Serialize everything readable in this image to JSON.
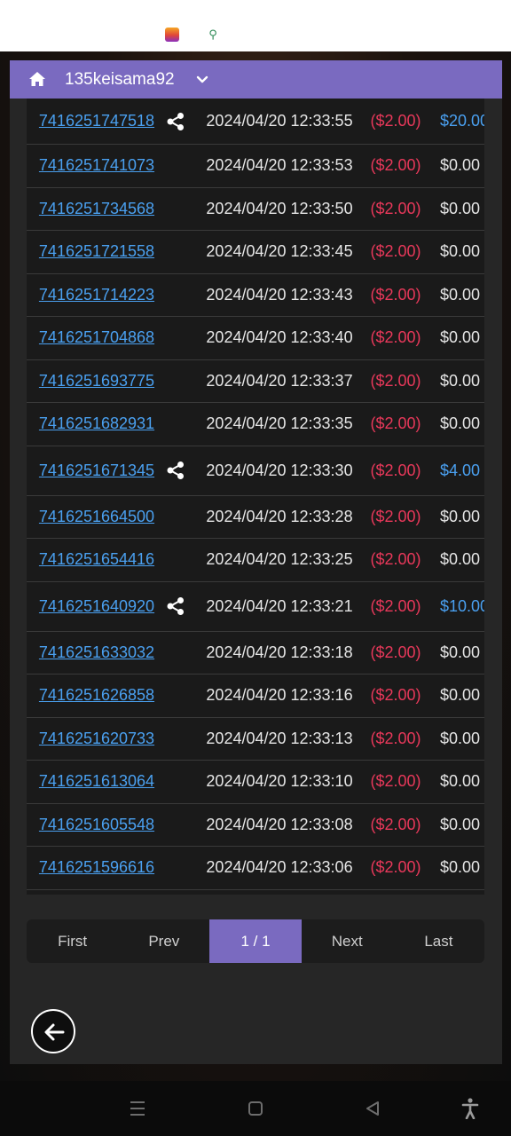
{
  "header": {
    "username": "135keisama92"
  },
  "rows": [
    {
      "id": "7416251747518",
      "share": true,
      "time": "2024/04/20 12:33:55",
      "bet": "($2.00)",
      "win": "$20.00",
      "win_positive": true
    },
    {
      "id": "7416251741073",
      "share": false,
      "time": "2024/04/20 12:33:53",
      "bet": "($2.00)",
      "win": "$0.00",
      "win_positive": false
    },
    {
      "id": "7416251734568",
      "share": false,
      "time": "2024/04/20 12:33:50",
      "bet": "($2.00)",
      "win": "$0.00",
      "win_positive": false
    },
    {
      "id": "7416251721558",
      "share": false,
      "time": "2024/04/20 12:33:45",
      "bet": "($2.00)",
      "win": "$0.00",
      "win_positive": false
    },
    {
      "id": "7416251714223",
      "share": false,
      "time": "2024/04/20 12:33:43",
      "bet": "($2.00)",
      "win": "$0.00",
      "win_positive": false
    },
    {
      "id": "7416251704868",
      "share": false,
      "time": "2024/04/20 12:33:40",
      "bet": "($2.00)",
      "win": "$0.00",
      "win_positive": false
    },
    {
      "id": "7416251693775",
      "share": false,
      "time": "2024/04/20 12:33:37",
      "bet": "($2.00)",
      "win": "$0.00",
      "win_positive": false
    },
    {
      "id": "7416251682931",
      "share": false,
      "time": "2024/04/20 12:33:35",
      "bet": "($2.00)",
      "win": "$0.00",
      "win_positive": false
    },
    {
      "id": "7416251671345",
      "share": true,
      "time": "2024/04/20 12:33:30",
      "bet": "($2.00)",
      "win": "$4.00",
      "win_positive": true
    },
    {
      "id": "7416251664500",
      "share": false,
      "time": "2024/04/20 12:33:28",
      "bet": "($2.00)",
      "win": "$0.00",
      "win_positive": false
    },
    {
      "id": "7416251654416",
      "share": false,
      "time": "2024/04/20 12:33:25",
      "bet": "($2.00)",
      "win": "$0.00",
      "win_positive": false
    },
    {
      "id": "7416251640920",
      "share": true,
      "time": "2024/04/20 12:33:21",
      "bet": "($2.00)",
      "win": "$10.00",
      "win_positive": true
    },
    {
      "id": "7416251633032",
      "share": false,
      "time": "2024/04/20 12:33:18",
      "bet": "($2.00)",
      "win": "$0.00",
      "win_positive": false
    },
    {
      "id": "7416251626858",
      "share": false,
      "time": "2024/04/20 12:33:16",
      "bet": "($2.00)",
      "win": "$0.00",
      "win_positive": false
    },
    {
      "id": "7416251620733",
      "share": false,
      "time": "2024/04/20 12:33:13",
      "bet": "($2.00)",
      "win": "$0.00",
      "win_positive": false
    },
    {
      "id": "7416251613064",
      "share": false,
      "time": "2024/04/20 12:33:10",
      "bet": "($2.00)",
      "win": "$0.00",
      "win_positive": false
    },
    {
      "id": "7416251605548",
      "share": false,
      "time": "2024/04/20 12:33:08",
      "bet": "($2.00)",
      "win": "$0.00",
      "win_positive": false
    },
    {
      "id": "7416251596616",
      "share": false,
      "time": "2024/04/20 12:33:06",
      "bet": "($2.00)",
      "win": "$0.00",
      "win_positive": false
    }
  ],
  "pagination": {
    "first": "First",
    "prev": "Prev",
    "current": "1 / 1",
    "next": "Next",
    "last": "Last"
  },
  "colors": {
    "accent": "#7a6ac0",
    "link": "#4aa0f0",
    "bet": "#e8385a"
  },
  "icons": {
    "home": "home-icon",
    "dropdown": "chevron-down-icon",
    "share": "share-icon",
    "back": "back-arrow-icon",
    "nav_recents": "recents-icon",
    "nav_home": "home-square-icon",
    "nav_back": "nav-back-icon",
    "accessibility": "accessibility-icon"
  }
}
